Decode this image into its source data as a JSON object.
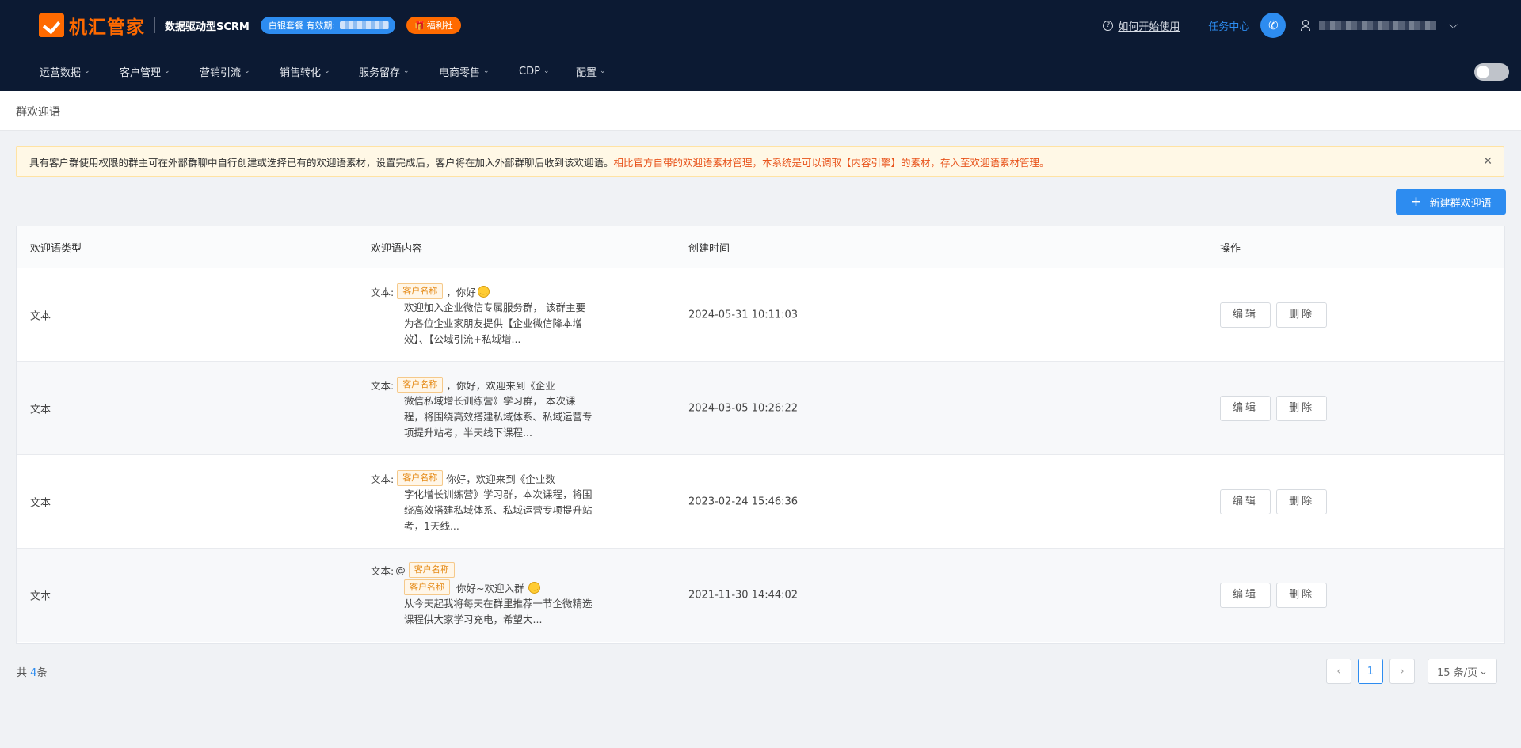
{
  "header": {
    "logo_text": "机汇管家",
    "subtitle": "数据驱动型SCRM",
    "package_label": "白银套餐 有效期:",
    "welfare_label": "福利社",
    "help_label": "如何开始使用",
    "task_center": "任务中心"
  },
  "nav": {
    "items": [
      {
        "label": "运营数据"
      },
      {
        "label": "客户管理"
      },
      {
        "label": "营销引流"
      },
      {
        "label": "销售转化"
      },
      {
        "label": "服务留存"
      },
      {
        "label": "电商零售"
      },
      {
        "label": "CDP"
      },
      {
        "label": "配置"
      }
    ]
  },
  "breadcrumb": {
    "title": "群欢迎语"
  },
  "notice": {
    "text": "具有客户群使用权限的群主可在外部群聊中自行创建或选择已有的欢迎语素材，设置完成后，客户将在加入外部群聊后收到该欢迎语。",
    "highlight": "相比官方自带的欢迎语素材管理，本系统是可以调取【内容引擎】的素材，存入至欢迎语素材管理。"
  },
  "actions": {
    "new_button": "新建群欢迎语"
  },
  "table": {
    "headers": {
      "type": "欢迎语类型",
      "content": "欢迎语内容",
      "time": "创建时间",
      "op": "操作"
    },
    "edit_label": "编辑",
    "delete_label": "删除",
    "text_prefix": "文本:",
    "tag_label": "客户名称",
    "rows": [
      {
        "type": "文本",
        "line1": "，你好",
        "body": "欢迎加入企业微信专属服务群， 该群主要为各位企业家朋友提供【企业微信降本增效】、【公域引流+私域增...",
        "time": "2024-05-31 10:11:03"
      },
      {
        "type": "文本",
        "line1": "，你好，欢迎来到《企业",
        "body": "微信私域增长训练营》学习群， 本次课程，将围绕高效搭建私域体系、私域运营专项提升站考，半天线下课程...",
        "time": "2024-03-05 10:26:22"
      },
      {
        "type": "文本",
        "line1": "你好，欢迎来到《企业数",
        "body": "字化增长训练营》学习群，本次课程，将围绕高效搭建私域体系、私域运营专项提升站考，1天线...",
        "time": "2023-02-24 15:46:36"
      },
      {
        "type": "文本",
        "line1": "@",
        "line2": "你好~欢迎入群",
        "body": "从今天起我将每天在群里推荐一节企微精选课程供大家学习充电，希望大...",
        "time": "2021-11-30 14:44:02"
      }
    ]
  },
  "footer": {
    "total_prefix": "共",
    "total_count": "4",
    "total_suffix": "条",
    "current_page": "1",
    "page_size": "15 条/页"
  }
}
